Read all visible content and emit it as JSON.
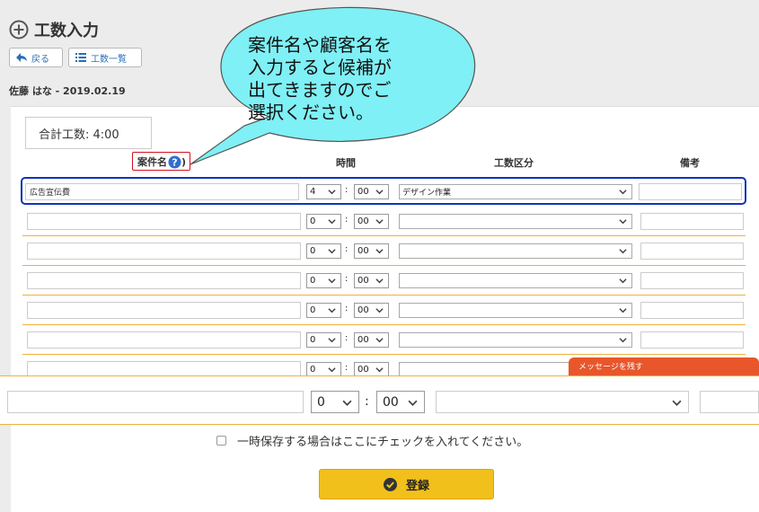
{
  "header": {
    "title": "工数入力",
    "back_label": "戻る",
    "list_label": "工数一覧",
    "user_date": "佐藤 はな - 2019.02.19"
  },
  "summary": {
    "total_label": "合計工数: 4:00"
  },
  "columns": {
    "project": "案件名",
    "time": "時間",
    "category": "工数区分",
    "note": "備考"
  },
  "rows": [
    {
      "project": "広告宣伝費",
      "hour": "4",
      "minute": "00",
      "category": "デザイン作業"
    },
    {
      "project": "",
      "hour": "0",
      "minute": "00",
      "category": ""
    },
    {
      "project": "",
      "hour": "0",
      "minute": "00",
      "category": ""
    },
    {
      "project": "",
      "hour": "0",
      "minute": "00",
      "category": ""
    },
    {
      "project": "",
      "hour": "0",
      "minute": "00",
      "category": ""
    },
    {
      "project": "",
      "hour": "0",
      "minute": "00",
      "category": ""
    },
    {
      "project": "",
      "hour": "0",
      "minute": "00",
      "category": ""
    }
  ],
  "zoomed_row": {
    "hour": "0",
    "minute": "00"
  },
  "message_tab": "メッセージを残す",
  "temp_save_label": "一時保存する場合はここにチェックを入れてください。",
  "register_label": "登録",
  "callout": {
    "lines": [
      "案件名や顧客名を",
      "入力すると候補が",
      "出てきますのでご",
      "選択ください。"
    ]
  },
  "colors": {
    "accent_blue": "#1034b8",
    "callout_fill": "#7ff0f5",
    "register_yellow": "#f2c01b",
    "message_orange": "#e8562a",
    "row_border": "#f0b040"
  }
}
